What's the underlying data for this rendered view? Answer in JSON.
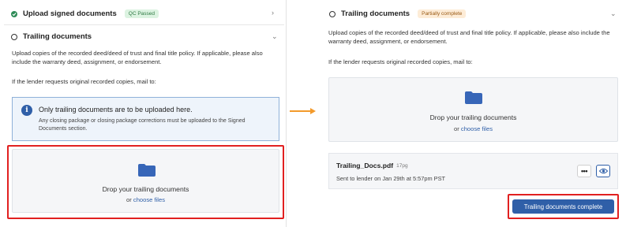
{
  "left": {
    "upload_section": {
      "title": "Upload signed documents",
      "badge": "QC Passed"
    },
    "trailing_section": {
      "title": "Trailing documents",
      "description": "Upload copies of the recorded deed/deed of trust and final title policy. If applicable, please also include the warranty deed, assignment, or endorsement.",
      "mail_note": "If the lender requests original recorded copies, mail to:"
    },
    "info": {
      "title": "Only trailing documents are to be uploaded here.",
      "subtitle": "Any closing package or closing package corrections must be uploaded to the Signed Documents section."
    },
    "dropzone": {
      "title": "Drop your trailing documents",
      "or_text": "or",
      "link": "choose files"
    }
  },
  "right": {
    "trailing_section": {
      "title": "Trailing documents",
      "badge": "Partially complete",
      "description": "Upload copies of the recorded deed/deed of trust and final title policy. If applicable, please also include the warranty deed, assignment, or endorsement.",
      "mail_note": "If the lender requests original recorded copies, mail to:"
    },
    "dropzone": {
      "title": "Drop your trailing documents",
      "or_text": "or",
      "link": "choose files"
    },
    "file": {
      "name": "Trailing_Docs.pdf",
      "pages": "17pg",
      "sent": "Sent to lender on Jan 29th at 5:57pm PST"
    },
    "complete_button": "Trailing documents complete"
  },
  "colors": {
    "accent": "#2f5fa8",
    "highlight": "#e12020",
    "arrow": "#f39a2b",
    "success": "#2e8b57"
  },
  "icons": [
    "check-circle-icon",
    "chevron-right-icon",
    "chevron-down-icon",
    "info-icon",
    "folder-icon",
    "more-icon",
    "eye-icon",
    "arrow-right-icon"
  ]
}
